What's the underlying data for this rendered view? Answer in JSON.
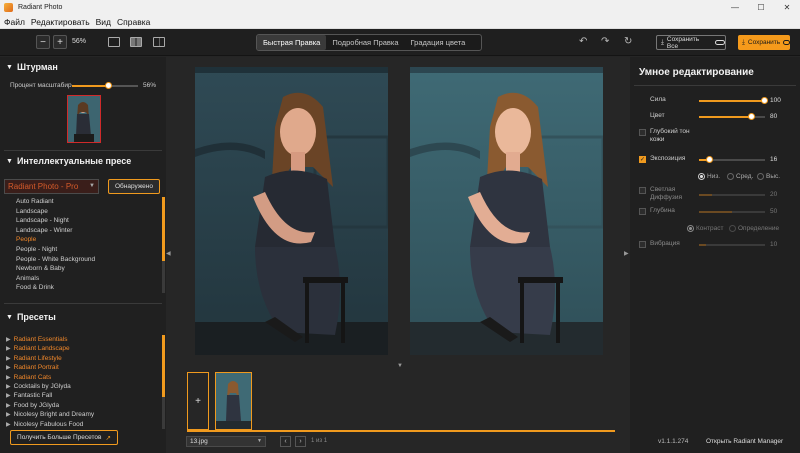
{
  "window": {
    "title": "Radiant Photo",
    "controls": [
      "—",
      "☐",
      "✕"
    ]
  },
  "menu": [
    "Файл",
    "Редактировать",
    "Вид",
    "Справка"
  ],
  "toolbar": {
    "zoom_out": "−",
    "zoom_in": "+",
    "zoom_value": "56%",
    "tabs": [
      "Быстрая Правка",
      "Подробная Правка",
      "Градация цвета"
    ],
    "active_tab": 0,
    "save_all": "Сохранить Все",
    "save": "Сохранить"
  },
  "navigator": {
    "title": "Штурман",
    "zoom_label": "Процент масштабир",
    "zoom_percent": "56%",
    "zoom_fraction": 0.56
  },
  "smart_presets": {
    "title": "Интеллектуальные пресе",
    "selected": "Radiant Photo - Pro",
    "found_button": "Обнаружено",
    "items": [
      "Auto Radiant",
      "Landscape",
      "Landscape - Night",
      "Landscape - Winter",
      "People",
      "People - Night",
      "People - White Background",
      "Newborn & Baby",
      "Animals",
      "Food & Drink"
    ],
    "highlighted_index": 4
  },
  "presets": {
    "title": "Пресеты",
    "items": [
      "Radiant Essentials",
      "Radiant Landscape",
      "Radiant Lifestyle",
      "Radiant Portrait",
      "Radiant Cats",
      "Cocktails by JGlyda",
      "Fantastic Fall",
      "Food by JGlyda",
      "Nicolesy Bright and Dreamy",
      "Nicolesy Fabulous Food"
    ],
    "highlighted": [
      0,
      1,
      2,
      3,
      4
    ],
    "more_button": "Получить Больше Пресетов"
  },
  "smart_edit": {
    "title": "Умное редактирование",
    "controls": [
      {
        "label": "Сила",
        "value": "100",
        "fraction": 1.0,
        "enabled": true,
        "checkbox": false
      },
      {
        "label": "Цвет",
        "value": "80",
        "fraction": 0.8,
        "enabled": true,
        "checkbox": false
      },
      {
        "label": "Глубокий тон кожи",
        "value": "",
        "enabled": true,
        "checkbox": true,
        "checked": false
      },
      {
        "label": "Экспозиция",
        "value": "16",
        "fraction": 0.16,
        "enabled": true,
        "checkbox": true,
        "checked": true
      },
      {
        "label": "Светлая Диффузия",
        "value": "20",
        "fraction": 0.2,
        "enabled": false,
        "checkbox": true,
        "checked": false
      },
      {
        "label": "Глубина",
        "value": "50",
        "fraction": 0.5,
        "enabled": false,
        "checkbox": true,
        "checked": false
      },
      {
        "label": "Вибрация",
        "value": "10",
        "fraction": 0.1,
        "enabled": false,
        "checkbox": true,
        "checked": false
      }
    ],
    "exposure_modes": [
      "Низ.",
      "Сред.",
      "Выс."
    ],
    "exposure_mode_selected": 0,
    "depth_modes": [
      "Контраст",
      "Определение"
    ],
    "depth_mode_selected": 0
  },
  "filmstrip": {
    "add": "+",
    "file": "13.jpg",
    "page_text": "1 из 1"
  },
  "footer": {
    "version": "v1.1.1.274",
    "manager_link": "Открыть Radiant Manager"
  },
  "colors": {
    "accent": "#f09a1e",
    "highlight_text": "#f0872a",
    "panel": "#202020"
  }
}
